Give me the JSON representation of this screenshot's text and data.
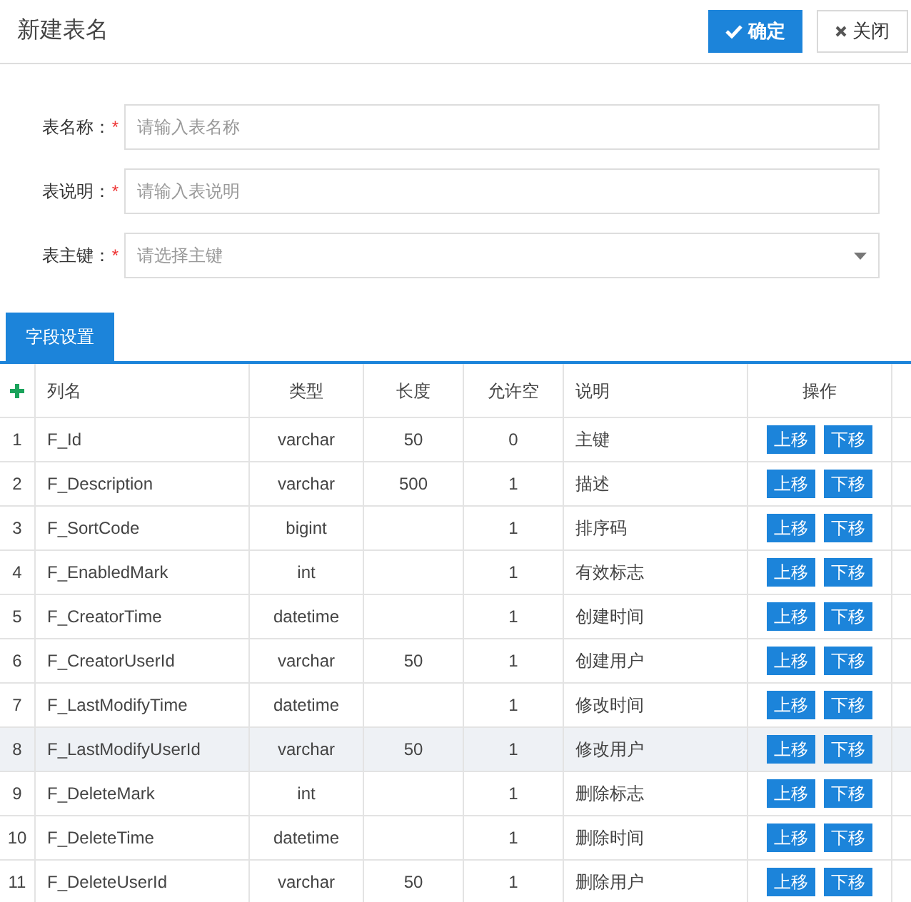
{
  "title": "新建表名",
  "buttons": [
    {
      "kind": "confirm",
      "label": "确定"
    },
    {
      "kind": "close",
      "label": "关闭"
    }
  ],
  "form": [
    {
      "kind": "input",
      "label": "表名称：",
      "required_mark": "*",
      "placeholder": "请输入表名称"
    },
    {
      "kind": "input",
      "label": "表说明：",
      "required_mark": "*",
      "placeholder": "请输入表说明"
    },
    {
      "kind": "select",
      "label": "表主键：",
      "required_mark": "*",
      "placeholder": "请选择主键"
    }
  ],
  "tabs": [
    {
      "label": "字段设置",
      "selected": true
    }
  ],
  "table": {
    "columns": [
      "列名",
      "类型",
      "长度",
      "允许空",
      "说明",
      "操作"
    ],
    "rows": [
      {
        "index": "1",
        "name": "F_Id",
        "type": "varchar",
        "length": "50",
        "nullable": "0",
        "description": "主键",
        "actions": [
          "上移",
          "下移"
        ],
        "selected": false
      },
      {
        "index": "2",
        "name": "F_Description",
        "type": "varchar",
        "length": "500",
        "nullable": "1",
        "description": "描述",
        "actions": [
          "上移",
          "下移"
        ],
        "selected": false
      },
      {
        "index": "3",
        "name": "F_SortCode",
        "type": "bigint",
        "nullable": "1",
        "description": "排序码",
        "actions": [
          "上移",
          "下移"
        ],
        "selected": false
      },
      {
        "index": "4",
        "name": "F_EnabledMark",
        "type": "int",
        "nullable": "1",
        "description": "有效标志",
        "actions": [
          "上移",
          "下移"
        ],
        "selected": false
      },
      {
        "index": "5",
        "name": "F_CreatorTime",
        "type": "datetime",
        "nullable": "1",
        "description": "创建时间",
        "actions": [
          "上移",
          "下移"
        ],
        "selected": false
      },
      {
        "index": "6",
        "name": "F_CreatorUserId",
        "type": "varchar",
        "length": "50",
        "nullable": "1",
        "description": "创建用户",
        "actions": [
          "上移",
          "下移"
        ],
        "selected": false
      },
      {
        "index": "7",
        "name": "F_LastModifyTime",
        "type": "datetime",
        "nullable": "1",
        "description": "修改时间",
        "actions": [
          "上移",
          "下移"
        ],
        "selected": false
      },
      {
        "index": "8",
        "name": "F_LastModifyUserId",
        "type": "varchar",
        "length": "50",
        "nullable": "1",
        "description": "修改用户",
        "actions": [
          "上移",
          "下移"
        ],
        "selected": true
      },
      {
        "index": "9",
        "name": "F_DeleteMark",
        "type": "int",
        "nullable": "1",
        "description": "删除标志",
        "actions": [
          "上移",
          "下移"
        ],
        "selected": false
      },
      {
        "index": "10",
        "name": "F_DeleteTime",
        "type": "datetime",
        "nullable": "1",
        "description": "删除时间",
        "actions": [
          "上移",
          "下移"
        ],
        "selected": false
      },
      {
        "index": "11",
        "name": "F_DeleteUserId",
        "type": "varchar",
        "length": "50",
        "nullable": "1",
        "description": "删除用户",
        "actions": [
          "上移",
          "下移"
        ],
        "selected": false
      }
    ]
  }
}
